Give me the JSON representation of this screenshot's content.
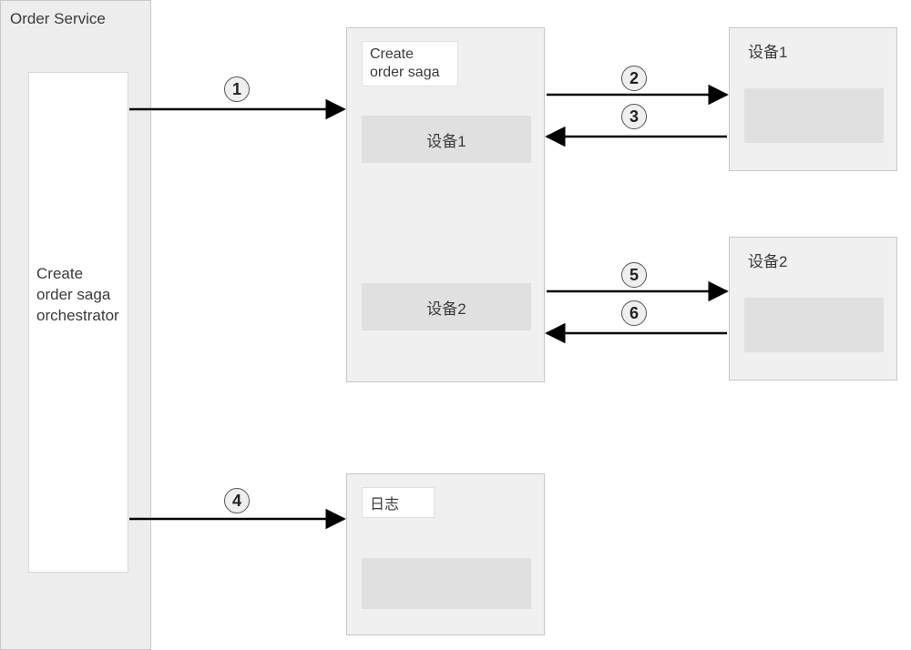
{
  "orderService": {
    "title": "Order Service",
    "orchestrator": "Create\norder saga\norchestrator"
  },
  "saga": {
    "title": "Create\norder saga",
    "device1": "设备1",
    "device2": "设备2"
  },
  "device1": {
    "title": "设备1"
  },
  "device2": {
    "title": "设备2"
  },
  "log": {
    "title": "日志"
  },
  "steps": {
    "s1": "1",
    "s2": "2",
    "s3": "3",
    "s4": "4",
    "s5": "5",
    "s6": "6"
  }
}
